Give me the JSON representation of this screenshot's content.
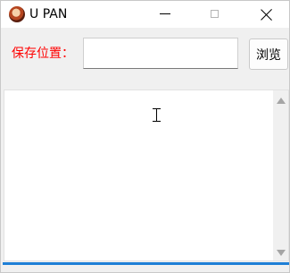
{
  "window": {
    "title": "U PAN",
    "icon": "app-avatar-icon",
    "controls": [
      "minimize-icon",
      "maximize-icon",
      "close-icon"
    ]
  },
  "form": {
    "save_label": "保存位置：",
    "path_value": "",
    "browse_label": "浏览"
  },
  "log": {
    "content": ""
  },
  "progress": {
    "value_percent": 100,
    "color": "#1e7fd6"
  },
  "colors": {
    "label": "#ff0000",
    "accent": "#1e7fd6"
  }
}
